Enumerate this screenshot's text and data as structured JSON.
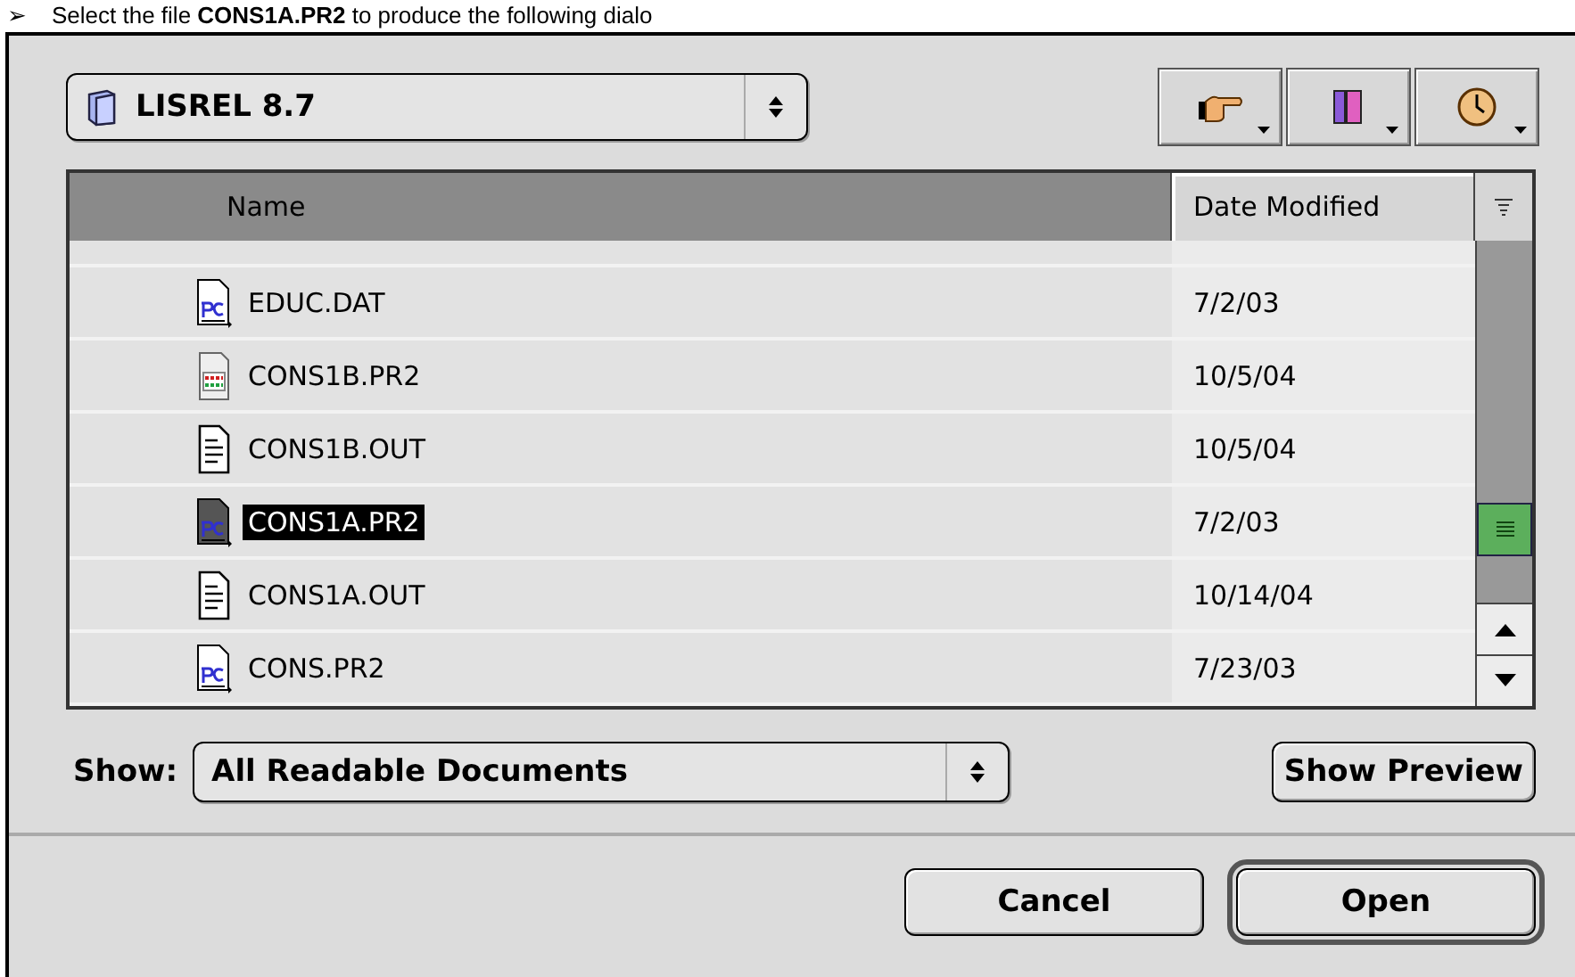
{
  "caption": {
    "bullet": "➢",
    "text": "Select the file **CONS1A.PR2** to produce the following dialo"
  },
  "folder_popup": {
    "label": "LISREL 8.7"
  },
  "toolbar": [
    {
      "kind": "shortcuts"
    },
    {
      "kind": "favorites"
    },
    {
      "kind": "recent"
    }
  ],
  "file_list": {
    "columns": [
      {
        "label": "Name",
        "sorted": true
      },
      {
        "label": "Date Modified",
        "sorted": false
      }
    ],
    "rows": [
      {
        "name": "EDUC.DAT",
        "date": "7/2/03",
        "kind": "pc",
        "selected": false
      },
      {
        "name": "CONS1B.PR2",
        "date": "10/5/04",
        "kind": "app",
        "selected": false
      },
      {
        "name": "CONS1B.OUT",
        "date": "10/5/04",
        "kind": "text",
        "selected": false
      },
      {
        "name": "CONS1A.PR2",
        "date": "7/2/03",
        "kind": "pc",
        "selected": true
      },
      {
        "name": "CONS1A.OUT",
        "date": "10/14/04",
        "kind": "text",
        "selected": false
      },
      {
        "name": "CONS.PR2",
        "date": "7/23/03",
        "kind": "pc",
        "selected": false
      }
    ]
  },
  "show": {
    "label": "Show:",
    "value": "All Readable Documents"
  },
  "preview_button": "Show Preview",
  "buttons": [
    {
      "label": "Cancel",
      "default": false
    },
    {
      "label": "Open",
      "default": true
    }
  ]
}
